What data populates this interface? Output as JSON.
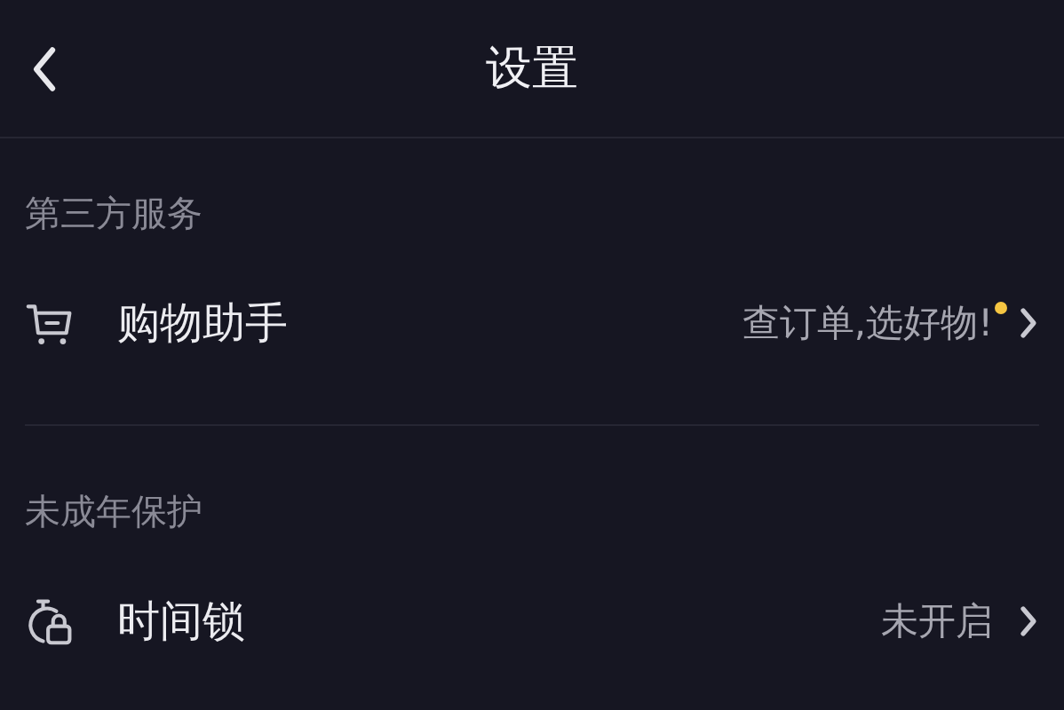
{
  "header": {
    "title": "设置"
  },
  "sections": [
    {
      "title": "第三方服务",
      "items": [
        {
          "kind": "cart",
          "label": "购物助手",
          "value": "查订单,选好物!",
          "badge": true
        }
      ]
    },
    {
      "title": "未成年保护",
      "items": [
        {
          "kind": "timelock",
          "label": "时间锁",
          "value": "未开启",
          "badge": false
        }
      ]
    }
  ]
}
